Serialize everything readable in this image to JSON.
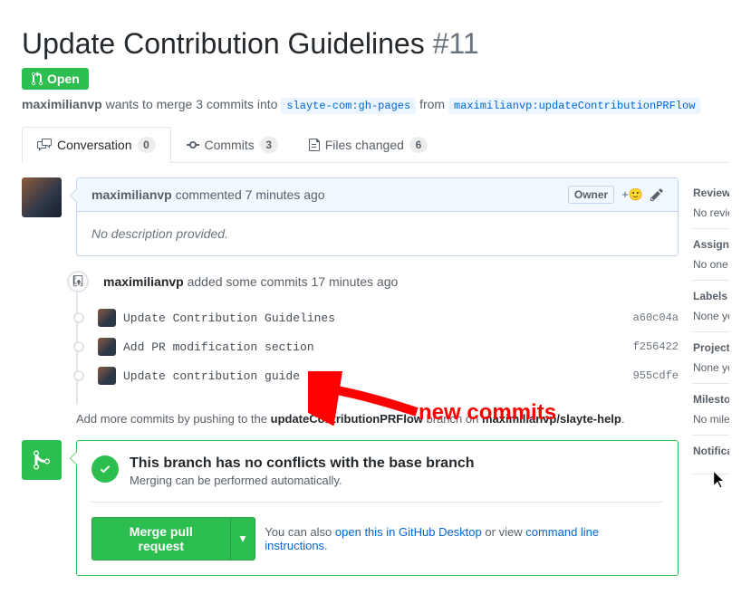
{
  "title": "Update Contribution Guidelines",
  "issue_number": "#11",
  "state": {
    "label": "Open"
  },
  "merge_desc": {
    "author": "maximilianvp",
    "verb": "wants to merge 3 commits into",
    "base_branch": "slayte-com:gh-pages",
    "from_word": "from",
    "head_branch": "maximilianvp:updateContributionPRFlow"
  },
  "tabs": {
    "conversation": {
      "label": "Conversation",
      "count": "0"
    },
    "commits": {
      "label": "Commits",
      "count": "3"
    },
    "files": {
      "label": "Files changed",
      "count": "6"
    }
  },
  "comment": {
    "author": "maximilianvp",
    "action": "commented",
    "timestamp": "7 minutes ago",
    "owner_badge": "Owner",
    "body": "No description provided."
  },
  "commits_block": {
    "author": "maximilianvp",
    "action": "added some commits",
    "timestamp": "17 minutes ago",
    "items": [
      {
        "msg": "Update Contribution Guidelines",
        "sha": "a60c04a"
      },
      {
        "msg": "Add PR modification section",
        "sha": "f256422"
      },
      {
        "msg": "Update contribution guide",
        "sha": "955cdfe"
      }
    ]
  },
  "push_hint": {
    "prefix": "Add more commits by pushing to the",
    "branch": "updateContributionPRFlow",
    "middle": "branch on",
    "repo": "maximilianvp/slayte-help"
  },
  "merge_box": {
    "title": "This branch has no conflicts with the base branch",
    "subtitle": "Merging can be performed automatically.",
    "button": "Merge pull request",
    "alt_prefix": "You can also",
    "alt_link1": "open this in GitHub Desktop",
    "alt_middle": "or view",
    "alt_link2": "command line instructions"
  },
  "sidebar": {
    "reviewers": {
      "heading": "Reviewers",
      "value": "No reviews"
    },
    "assignees": {
      "heading": "Assignees",
      "value": "No one assigned"
    },
    "labels": {
      "heading": "Labels",
      "value": "None yet"
    },
    "projects": {
      "heading": "Projects",
      "value": "None yet"
    },
    "milestone": {
      "heading": "Milestone",
      "value": "No milestone"
    },
    "notifications": {
      "heading": "Notifications"
    }
  },
  "annotation": "new commits"
}
